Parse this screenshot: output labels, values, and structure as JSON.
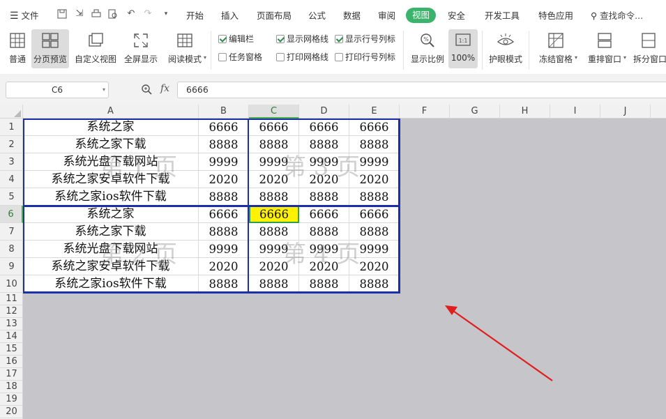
{
  "menubar": {
    "file_label": "文件",
    "items": [
      "开始",
      "插入",
      "页面布局",
      "公式",
      "数据",
      "审阅",
      "视图",
      "安全",
      "开发工具",
      "特色应用"
    ],
    "active_item": "视图",
    "search_placeholder": "查找命令...",
    "accent": "#3bb36c"
  },
  "ribbon": {
    "buttons": [
      "普通",
      "分页预览",
      "自定义视图",
      "全屏显示",
      "阅读模式",
      "显示比例",
      "100%",
      "护眼模式",
      "冻结窗格",
      "重排窗口",
      "拆分窗口"
    ],
    "checkboxes": {
      "edit_bar": {
        "label": "编辑栏",
        "checked": true
      },
      "task_pane": {
        "label": "任务窗格",
        "checked": false
      },
      "show_gridlines": {
        "label": "显示网格线",
        "checked": true
      },
      "print_gridlines": {
        "label": "打印网格线",
        "checked": false
      },
      "show_headers": {
        "label": "显示行号列标",
        "checked": true
      },
      "print_headers": {
        "label": "打印行号列标",
        "checked": false
      }
    }
  },
  "formula_bar": {
    "name_box": "C6",
    "fx": "fx",
    "value": "6666"
  },
  "grid": {
    "columns": [
      "A",
      "B",
      "C",
      "D",
      "E",
      "F",
      "G",
      "H",
      "I",
      "J"
    ],
    "rows": [
      "1",
      "2",
      "3",
      "4",
      "5",
      "6",
      "7",
      "8",
      "9",
      "10",
      "11",
      "12",
      "13",
      "14",
      "15",
      "16",
      "17",
      "18",
      "19",
      "20"
    ],
    "selected_cell": "C6",
    "data": [
      [
        "系统之家",
        "6666",
        "6666",
        "6666",
        "6666"
      ],
      [
        "系统之家下载",
        "8888",
        "8888",
        "8888",
        "8888"
      ],
      [
        "系统光盘下载网站",
        "9999",
        "9999",
        "9999",
        "9999"
      ],
      [
        "系统之家安卓软件下载",
        "2020",
        "2020",
        "2020",
        "2020"
      ],
      [
        "系统之家ios软件下载",
        "8888",
        "8888",
        "8888",
        "8888"
      ],
      [
        "系统之家",
        "6666",
        "6666",
        "6666",
        "6666"
      ],
      [
        "系统之家下载",
        "8888",
        "8888",
        "8888",
        "8888"
      ],
      [
        "系统光盘下载网站",
        "9999",
        "9999",
        "9999",
        "9999"
      ],
      [
        "系统之家安卓软件下载",
        "2020",
        "2020",
        "2020",
        "2020"
      ],
      [
        "系统之家ios软件下载",
        "8888",
        "8888",
        "8888",
        "8888"
      ]
    ],
    "watermarks": [
      "第 1 页",
      "第 3 页",
      "第 2 页",
      "第 4 页"
    ],
    "highlight_color": "#fff200",
    "page_break_color": "#1a2fa8"
  },
  "annotation": {
    "arrow_color": "#e11d1d"
  }
}
